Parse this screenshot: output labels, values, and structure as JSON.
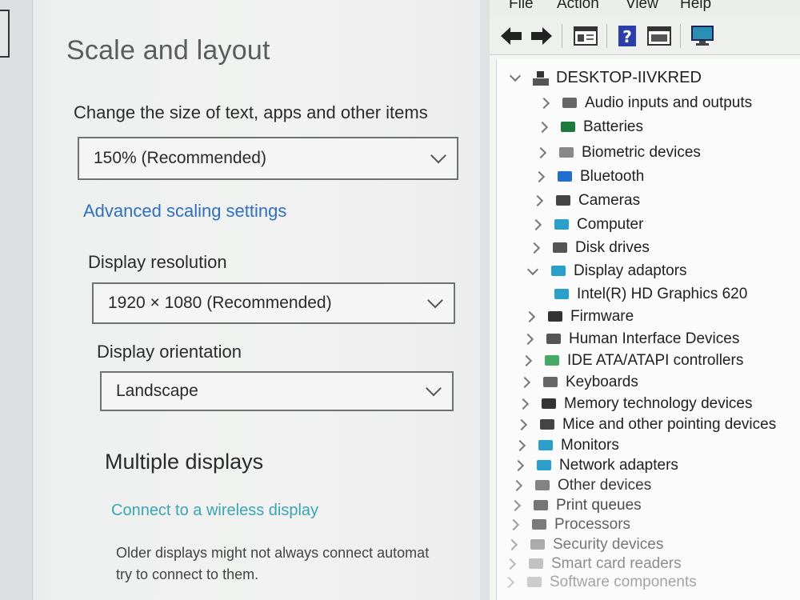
{
  "settings": {
    "title": "Scale and layout",
    "scale_label": "Change the size of text, apps and other items",
    "scale_value": "150% (Recommended)",
    "advanced_link": "Advanced scaling settings",
    "resolution_label": "Display resolution",
    "resolution_value": "1920 × 1080 (Recommended)",
    "orientation_label": "Display orientation",
    "orientation_value": "Landscape",
    "multiple_heading": "Multiple displays",
    "wireless_link": "Connect to a wireless display",
    "older_line1": "Older displays might not always connect automat",
    "older_line2": "try to connect to them."
  },
  "devmgr": {
    "menu": [
      "File",
      "Action",
      "View",
      "Help"
    ],
    "root": "DESKTOP-IIVKRED",
    "items": [
      {
        "label": "Audio inputs and outputs",
        "icon": "speaker-icon"
      },
      {
        "label": "Batteries",
        "icon": "battery-icon"
      },
      {
        "label": "Biometric devices",
        "icon": "fingerprint-icon"
      },
      {
        "label": "Bluetooth",
        "icon": "bluetooth-icon"
      },
      {
        "label": "Cameras",
        "icon": "camera-icon"
      },
      {
        "label": "Computer",
        "icon": "monitor-icon"
      },
      {
        "label": "Disk drives",
        "icon": "disk-icon"
      },
      {
        "label": "Display adaptors",
        "icon": "display-adapter-icon"
      },
      {
        "label": "Intel(R) HD Graphics 620",
        "icon": "display-adapter-icon"
      },
      {
        "label": "Firmware",
        "icon": "chip-icon"
      },
      {
        "label": "Human Interface Devices",
        "icon": "hid-icon"
      },
      {
        "label": "IDE ATA/ATAPI controllers",
        "icon": "ide-icon"
      },
      {
        "label": "Keyboards",
        "icon": "keyboard-icon"
      },
      {
        "label": "Memory technology devices",
        "icon": "memory-icon"
      },
      {
        "label": "Mice and other pointing devices",
        "icon": "mouse-icon"
      },
      {
        "label": "Monitors",
        "icon": "monitor-icon"
      },
      {
        "label": "Network adapters",
        "icon": "network-icon"
      },
      {
        "label": "Other devices",
        "icon": "other-device-icon"
      },
      {
        "label": "Print queues",
        "icon": "printer-icon"
      },
      {
        "label": "Processors",
        "icon": "processor-icon"
      },
      {
        "label": "Security devices",
        "icon": "security-icon"
      },
      {
        "label": "Smart card readers",
        "icon": "smartcard-icon"
      },
      {
        "label": "Software components",
        "icon": "software-icon"
      }
    ]
  }
}
